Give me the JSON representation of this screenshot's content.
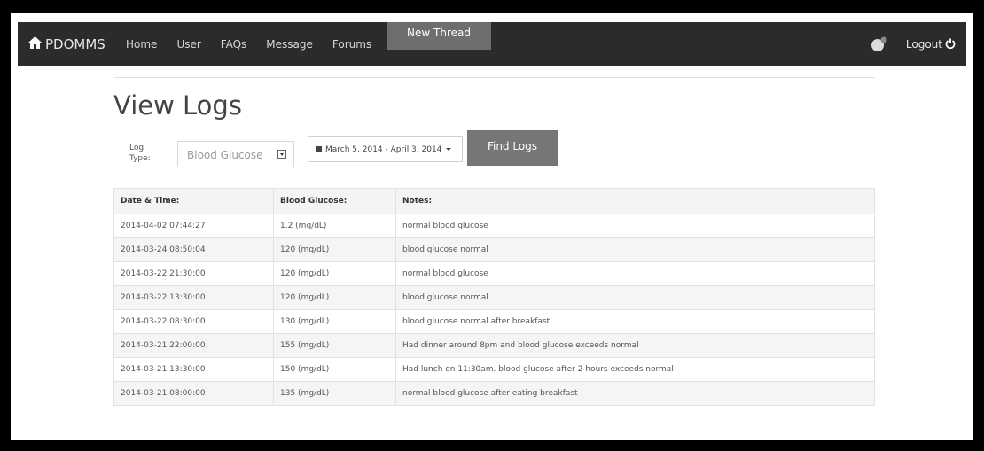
{
  "nav": {
    "brand": "PDOMMS",
    "links": [
      "Home",
      "User",
      "FAQs",
      "Message",
      "Forums"
    ],
    "new_thread": "New Thread",
    "logout": "Logout"
  },
  "page": {
    "title": "View Logs"
  },
  "filters": {
    "log_type_label_line1": "Log",
    "log_type_label_line2": "Type:",
    "log_type_value": "Blood Glucose",
    "date_range": "March 5, 2014 - April 3, 2014",
    "find_button": "Find Logs"
  },
  "table": {
    "headers": [
      "Date & Time:",
      "Blood Glucose:",
      "Notes:"
    ],
    "rows": [
      [
        "2014-04-02 07:44:27",
        "1.2 (mg/dL)",
        "normal blood glucose"
      ],
      [
        "2014-03-24 08:50:04",
        "120 (mg/dL)",
        "blood glucose normal"
      ],
      [
        "2014-03-22 21:30:00",
        "120 (mg/dL)",
        "normal blood glucose"
      ],
      [
        "2014-03-22 13:30:00",
        "120 (mg/dL)",
        "blood glucose normal"
      ],
      [
        "2014-03-22 08:30:00",
        "130 (mg/dL)",
        "blood glucose normal after breakfast"
      ],
      [
        "2014-03-21 22:00:00",
        "155 (mg/dL)",
        "Had dinner around 8pm and blood glucose exceeds normal"
      ],
      [
        "2014-03-21 13:30:00",
        "150 (mg/dL)",
        "Had lunch on 11:30am. blood glucose after 2 hours exceeds normal"
      ],
      [
        "2014-03-21 08:00:00",
        "135 (mg/dL)",
        "normal blood glucose after eating breakfast"
      ]
    ]
  }
}
